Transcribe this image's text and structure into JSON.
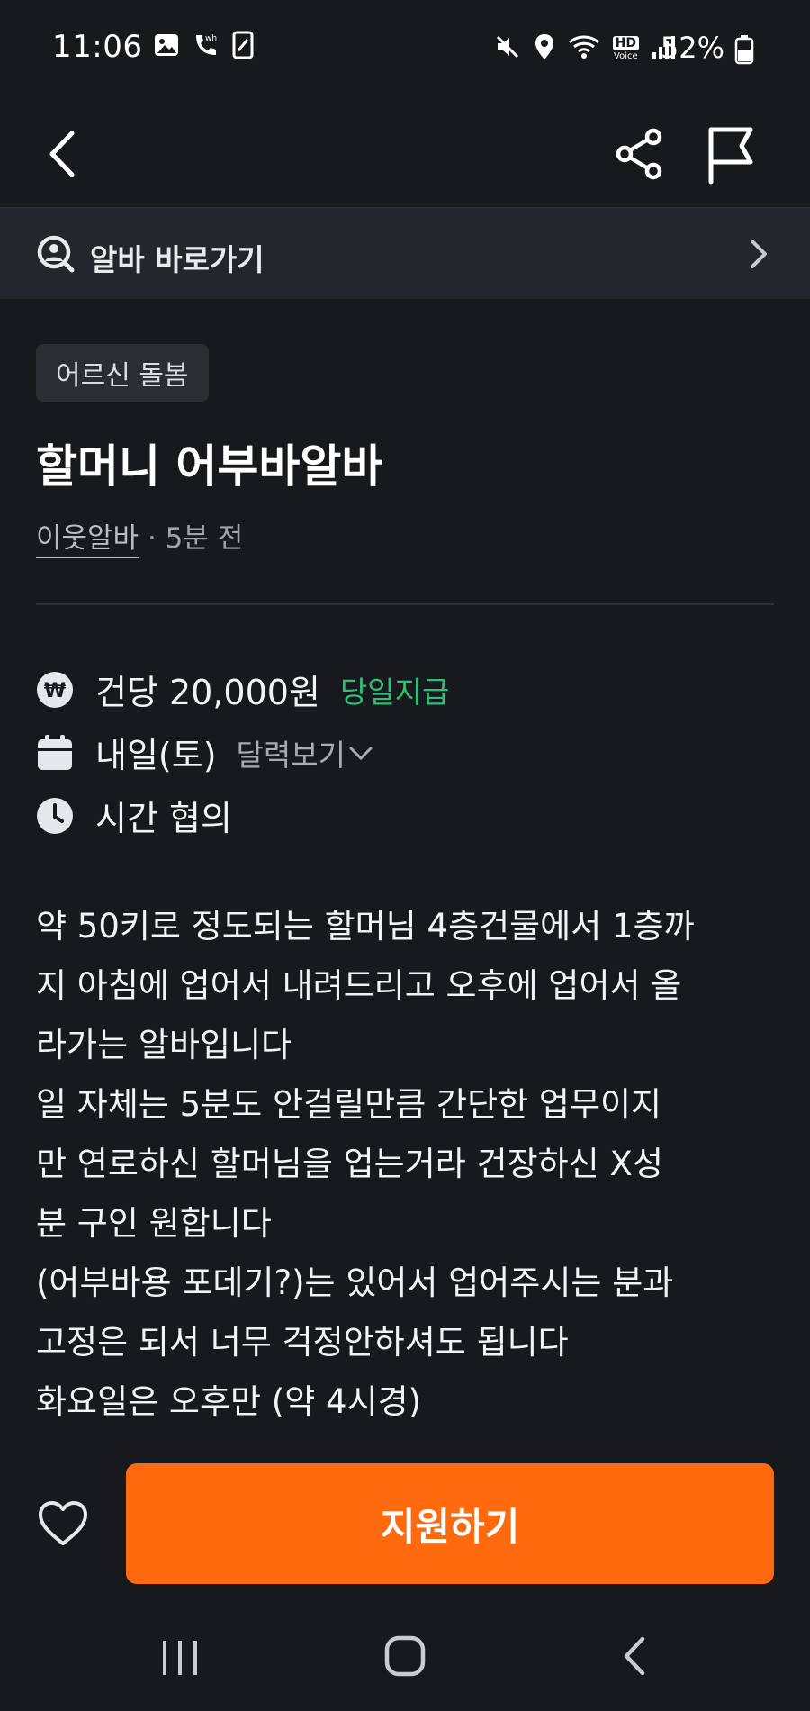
{
  "status_bar": {
    "time": "11:06",
    "battery_text": "52%",
    "icons": [
      "gallery-icon",
      "wifi-calling-icon",
      "phone-device-icon",
      "mute-icon",
      "location-icon",
      "wifi-icon",
      "hd-voice-icon",
      "signal-icon",
      "battery-icon"
    ],
    "hd_label": "HD",
    "voice_label": "Voice"
  },
  "app_bar": {
    "icons": [
      "back-arrow-icon",
      "share-icon",
      "report-flag-icon"
    ]
  },
  "shortcut": {
    "label": "알바 바로가기"
  },
  "post": {
    "category_tag": "어르신 돌봄",
    "title": "할머니 어부바알바",
    "author": "이웃알바",
    "separator": " · ",
    "time_ago": "5분 전"
  },
  "details": {
    "pay": "건당 20,000원",
    "pay_badge": "당일지급",
    "date": "내일(토)",
    "calendar_link": "달력보기",
    "time": "시간 협의",
    "won_symbol": "₩"
  },
  "description_lines": [
    "약 50키로 정도되는 할머님 4층건물에서 1층까",
    "지 아침에 업어서 내려드리고 오후에 업어서 올",
    "라가는 알바입니다",
    "일 자체는 5분도 안걸릴만큼 간단한 업무이지",
    "만 연로하신 할머님을 업는거라 건장하신 X성",
    "분 구인 원합니다",
    "(어부바용 포데기?)는 있어서 업어주시는 분과",
    "고정은 되서 너무 걱정안하셔도 됩니다",
    "화요일은 오후만 (약 4시경)"
  ],
  "actions": {
    "apply_label": "지원하기"
  },
  "colors": {
    "background": "#18191d",
    "banner": "#23262c",
    "accent_orange": "#ff6a0e",
    "pay_green": "#2fbf7a"
  }
}
